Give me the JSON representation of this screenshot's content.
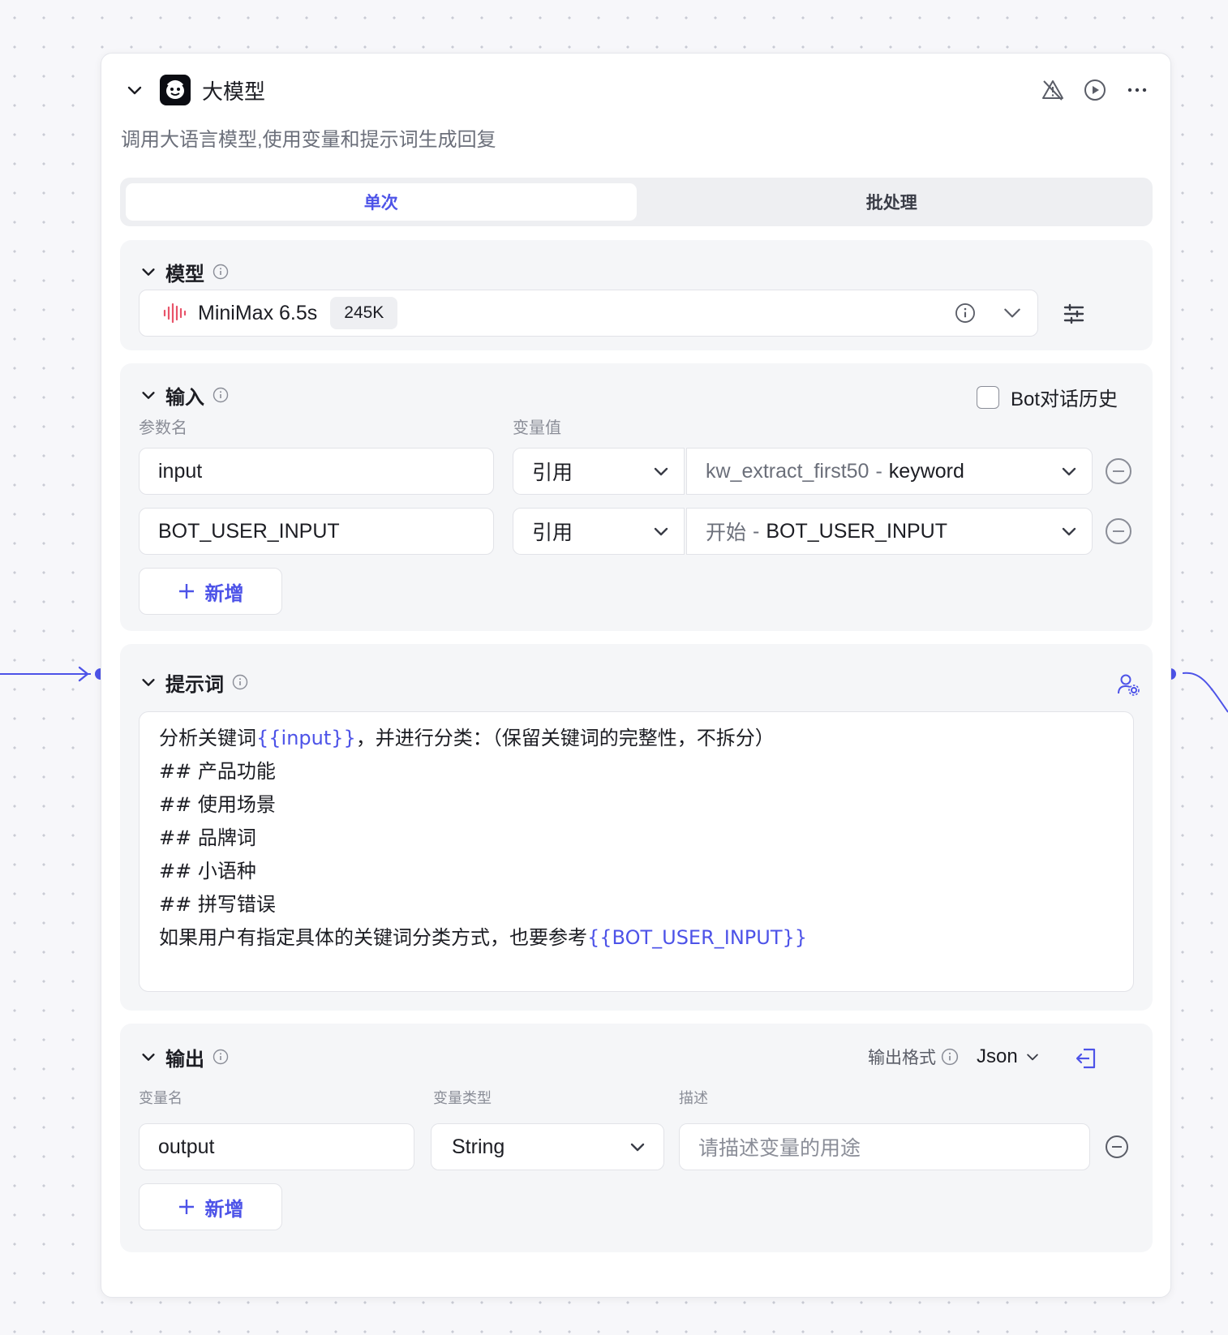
{
  "node": {
    "title": "大模型",
    "description": "调用大语言模型,使用变量和提示词生成回复"
  },
  "mode_tabs": [
    {
      "label": "单次",
      "active": true
    },
    {
      "label": "批处理",
      "active": false
    }
  ],
  "model_section": {
    "title": "模型",
    "model_name": "MiniMax 6.5s",
    "context_badge": "245K"
  },
  "input_section": {
    "title": "输入",
    "history_checkbox_label": "Bot对话历史",
    "history_checked": false,
    "col_param_name": "参数名",
    "col_var_value": "变量值",
    "rows": [
      {
        "name": "input",
        "type": "引用",
        "value_source": "kw_extract_first50",
        "value_field": "keyword"
      },
      {
        "name": "BOT_USER_INPUT",
        "type": "引用",
        "value_source": "开始",
        "value_field": "BOT_USER_INPUT"
      }
    ],
    "add_label": "新增"
  },
  "prompt_section": {
    "title": "提示词",
    "line1_prefix": "分析关键词",
    "line1_var": "{{input}}",
    "line1_suffix": "，并进行分类：（保留关键词的完整性，不拆分）",
    "lines": [
      "## 产品功能",
      "## 使用场景",
      "## 品牌词",
      "## 小语种",
      "## 拼写错误"
    ],
    "last_prefix": "如果用户有指定具体的关键词分类方式，也要参考",
    "last_var": "{{BOT_USER_INPUT}}"
  },
  "output_section": {
    "title": "输出",
    "format_label": "输出格式",
    "format_value": "Json",
    "col_var_name": "变量名",
    "col_var_type": "变量类型",
    "col_desc": "描述",
    "row": {
      "name": "output",
      "type": "String",
      "desc_placeholder": "请描述变量的用途"
    },
    "add_label": "新增"
  },
  "colors": {
    "accent": "#4d53e8",
    "section_bg": "#f5f6f8",
    "model_icon": "#e8546a"
  }
}
